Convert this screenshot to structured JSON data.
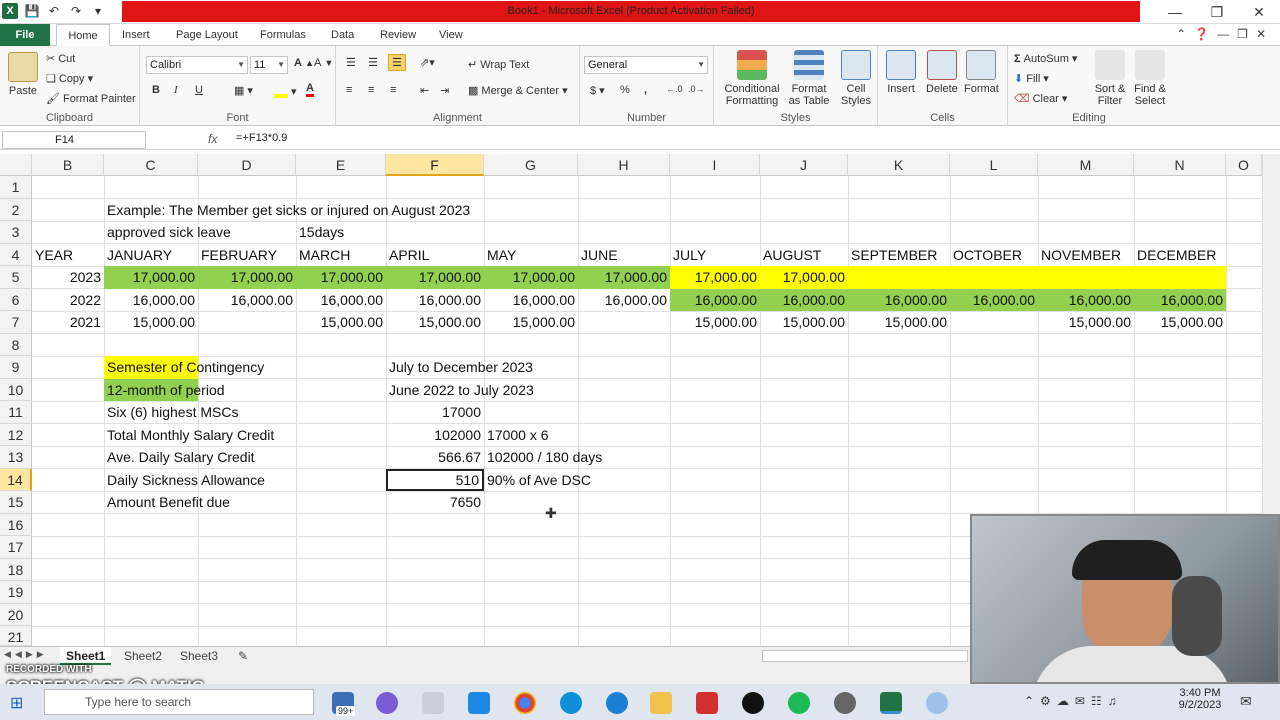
{
  "window": {
    "title": "Book1 - Microsoft Excel (Product Activation Failed)",
    "accent": "#217346",
    "title_highlight": "#e01414"
  },
  "ribbon_tabs": [
    "File",
    "Home",
    "Insert",
    "Page Layout",
    "Formulas",
    "Data",
    "Review",
    "View"
  ],
  "ribbon": {
    "clipboard": {
      "paste": "Paste",
      "cut": "Cut",
      "copy": "Copy",
      "format_painter": "Format Painter",
      "label": "Clipboard"
    },
    "font": {
      "name": "Calibri",
      "size": "11",
      "bold": "B",
      "italic": "I",
      "underline": "U",
      "label": "Font"
    },
    "alignment": {
      "wrap": "Wrap Text",
      "merge": "Merge & Center",
      "label": "Alignment"
    },
    "number": {
      "format": "General",
      "currency": "$",
      "percent": "%",
      "comma": ",",
      "label": "Number"
    },
    "styles": {
      "conditional": "Conditional Formatting",
      "table": "Format as Table",
      "cell": "Cell Styles",
      "label": "Styles"
    },
    "cells": {
      "insert": "Insert",
      "delete": "Delete",
      "format": "Format",
      "label": "Cells"
    },
    "editing": {
      "autosum": "AutoSum",
      "fill": "Fill",
      "clear": "Clear",
      "sort": "Sort & Filter",
      "find": "Find & Select",
      "label": "Editing"
    }
  },
  "formula_bar": {
    "cell_ref": "F14",
    "fx": "fx",
    "formula": "=+F13*0.9"
  },
  "columns": [
    "B",
    "C",
    "D",
    "E",
    "F",
    "G",
    "H",
    "I",
    "J",
    "K",
    "L",
    "M",
    "N",
    "O"
  ],
  "selected_column": "F",
  "rows": [
    "1",
    "2",
    "3",
    "4",
    "5",
    "6",
    "7",
    "8",
    "9",
    "10",
    "11",
    "12",
    "13",
    "14",
    "15",
    "16",
    "17",
    "18",
    "19",
    "20",
    "21"
  ],
  "selected_row": "14",
  "colors": {
    "yellow": "#ffff00",
    "green": "#92d050",
    "selection_header": "#ffe7a2"
  },
  "cells": {
    "c2": "Example: The Member get sicks or injured on August 2023",
    "c3": "approved sick leave",
    "e3": "15days",
    "months": [
      "JANUARY",
      "FEBRUARY",
      "MARCH",
      "APRIL",
      "MAY",
      "JUNE",
      "JULY",
      "AUGUST",
      "SEPTEMBER",
      "OCTOBER",
      "NOVEMBER",
      "DECEMBER"
    ],
    "year_header": "YEAR",
    "y2023": "2023",
    "y2022": "2022",
    "y2021": "2021",
    "r5": [
      "17,000.00",
      "17,000.00",
      "17,000.00",
      "17,000.00",
      "17,000.00",
      "17,000.00",
      "17,000.00",
      "17,000.00"
    ],
    "r6": [
      "16,000.00",
      "16,000.00",
      "16,000.00",
      "16,000.00",
      "16,000.00",
      "16,000.00",
      "16,000.00",
      "16,000.00",
      "16,000.00",
      "16,000.00",
      "16,000.00",
      "16,000.00"
    ],
    "r7": [
      "15,000.00",
      "15,000.00",
      "15,000.00",
      "15,000.00",
      "15,000.00",
      "15,000.00",
      "15,000.00",
      "15,000.00",
      "15,000.00"
    ],
    "c9": "Semester of Contingency",
    "f9": "July to December 2023",
    "c10": "12-month of period",
    "f10": "June 2022 to July 2023",
    "c11": "Six (6) highest MSCs",
    "f11": "17000",
    "c12": "Total Monthly Salary Credit",
    "f12": "102000",
    "g12": "17000 x 6",
    "c13": "Ave. Daily Salary Credit",
    "f13": "566.67",
    "g13": "102000 / 180 days",
    "c14": "Daily Sickness Allowance",
    "f14": "510",
    "g14": "90% of Ave DSC",
    "c15": "Amount Benefit due",
    "f15": "7650"
  },
  "sheets": [
    "Sheet1",
    "Sheet2",
    "Sheet3"
  ],
  "watermark": {
    "line1": "RECORDED WITH",
    "line2": "SCREENCAST",
    "line3": "MATIC"
  },
  "taskbar": {
    "search": "Type here to search",
    "badge": "99+",
    "time": "3:40 PM",
    "date": "9/2/2023"
  }
}
